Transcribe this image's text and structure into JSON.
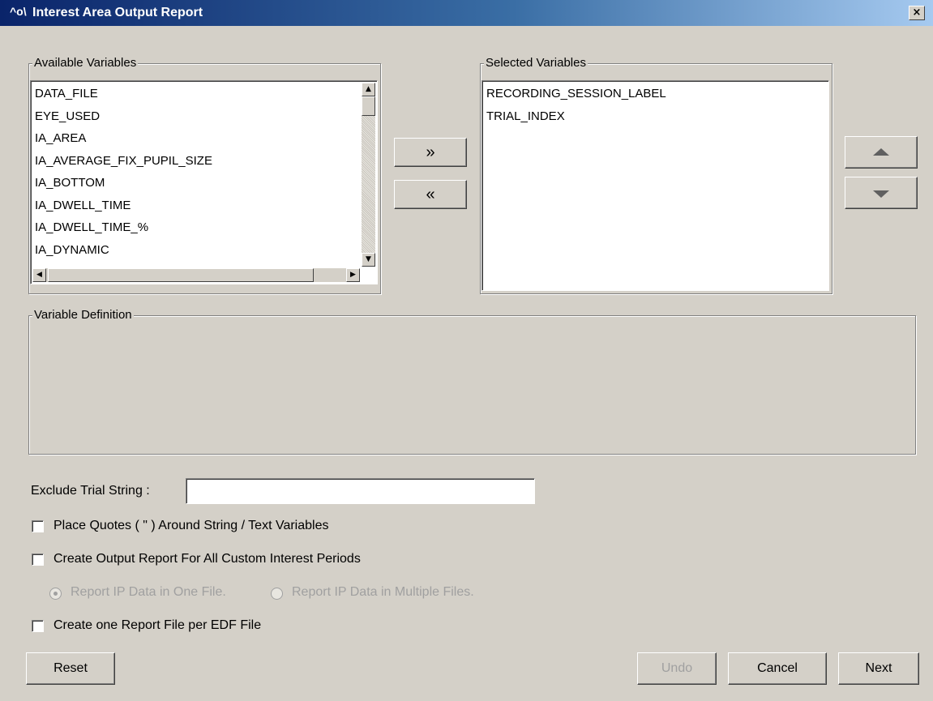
{
  "window": {
    "title": "Interest Area Output Report",
    "icon_name": "eyelink-app-icon",
    "icon_glyph": "^o\\",
    "close_glyph": "×"
  },
  "available": {
    "label": "Available Variables",
    "items": [
      "DATA_FILE",
      "EYE_USED",
      "IA_AREA",
      "IA_AVERAGE_FIX_PUPIL_SIZE",
      "IA_BOTTOM",
      "IA_DWELL_TIME",
      "IA_DWELL_TIME_%",
      "IA_DYNAMIC"
    ]
  },
  "selected": {
    "label": "Selected Variables",
    "items": [
      "RECORDING_SESSION_LABEL",
      "TRIAL_INDEX"
    ]
  },
  "transfer": {
    "add_label": "»",
    "remove_label": "«"
  },
  "definition": {
    "label": "Variable Definition"
  },
  "exclude": {
    "label": "Exclude Trial String :",
    "value": ""
  },
  "options": {
    "quotes_label": "Place Quotes ( \" ) Around String / Text Variables",
    "custom_ip_label": "Create Output Report For All Custom Interest Periods",
    "ip_one_file_label": "Report IP Data in One File.",
    "ip_multi_file_label": "Report IP Data in Multiple Files.",
    "per_edf_label": "Create one Report File per EDF File"
  },
  "buttons": {
    "reset": "Reset",
    "undo": "Undo",
    "cancel": "Cancel",
    "next": "Next"
  }
}
